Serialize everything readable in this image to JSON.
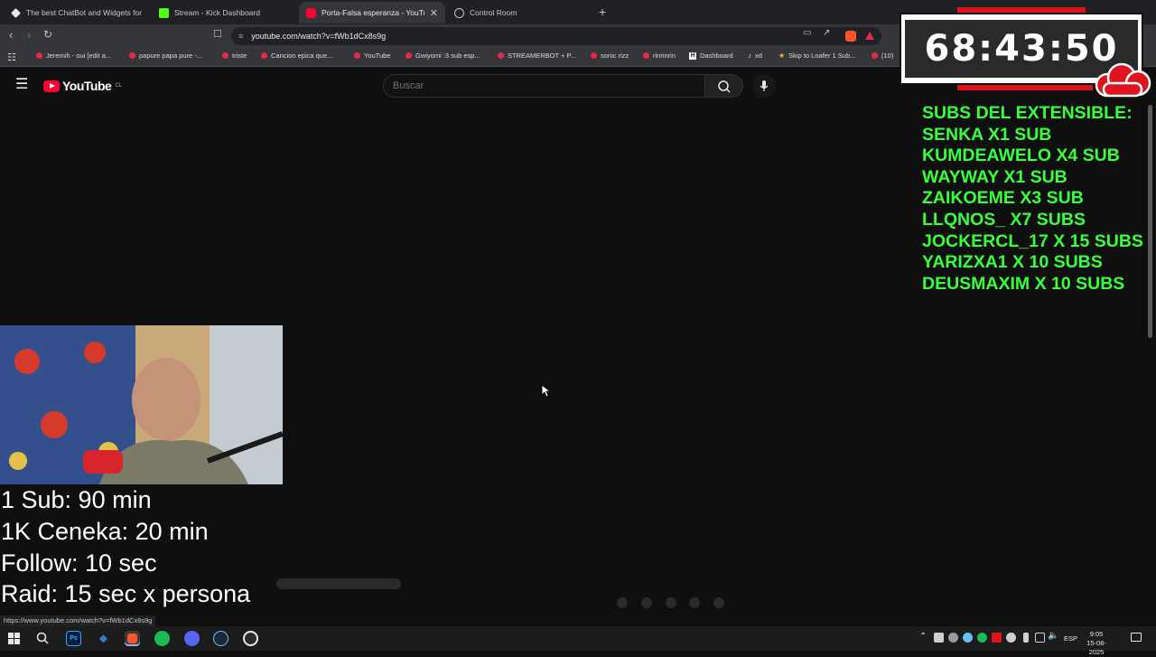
{
  "browser": {
    "tabs": [
      {
        "title": "The best ChatBot and Widgets for Ki",
        "icon": "diamond-icon",
        "color": "#e8eaed",
        "active": false
      },
      {
        "title": "Stream - Kick Dashboard",
        "icon": "kick-icon",
        "color": "#53fc18",
        "active": false
      },
      {
        "title": "Porta-Falsa esperanza - YouTube",
        "icon": "youtube-icon",
        "color": "#ff0033",
        "active": true
      },
      {
        "title": "Control Room",
        "icon": "globe-icon",
        "color": "#bdc1c6",
        "active": false
      }
    ],
    "new_tab_label": "+",
    "url": "youtube.com/watch?v=fWb1dCx8s9g",
    "bookmarks": [
      "Jeremih - oui [edit a...",
      "papure papa pure -...",
      "triste",
      "Cancion epica que...",
      "YouTube",
      "Gwiyomi :3 sub esp...",
      "STREAMERBOT + P...",
      "sonic rizz",
      "rinrinrin",
      "Dashboard",
      "xd",
      "Skip to Loafer 1 Sub...",
      "(10)"
    ],
    "status_url": "https://www.youtube.com/watch?v=fWb1dCx8s9g"
  },
  "youtube": {
    "logo_text": "YouTube",
    "country_code": "CL",
    "search_placeholder": "Buscar"
  },
  "overlay": {
    "timer": "68:43:50",
    "subs_title": "SUBS DEL EXTENSIBLE:",
    "subs": [
      "SENKA X1 SUB",
      "KUMDEAWELO X4 SUB",
      "WAYWAY X1 SUB",
      "ZAIKOEME X3 SUB",
      "LLQNOS_ X7 SUBS",
      "JOCKERCL_17 X 15 SUBS",
      "YARIZXA1 X 10 SUBS",
      "DEUSMAXIM X 10 SUBS"
    ],
    "rates": [
      "1 Sub: 90 min",
      "1K Ceneka: 20 min",
      "Follow: 10 sec",
      "Raid: 15 sec x persona"
    ],
    "subs_color": "#37ff3a"
  },
  "taskbar": {
    "language": "ESP",
    "time": "9:05",
    "date": "15-08-2025"
  }
}
